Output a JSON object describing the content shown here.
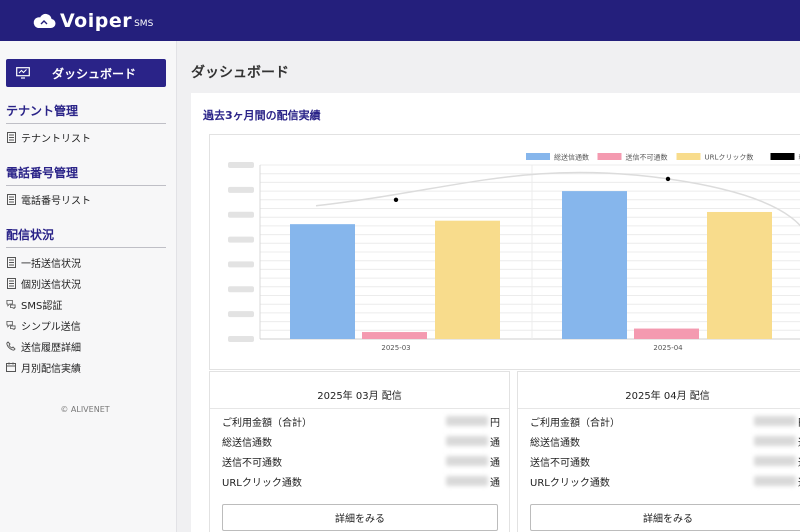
{
  "header": {
    "brand": "Voiper",
    "brand_sub": "SMS"
  },
  "sidebar": {
    "dashboard_label": "ダッシュボード",
    "sections": [
      {
        "title": "テナント管理",
        "items": [
          {
            "label": "テナントリスト",
            "icon": "list-icon"
          }
        ]
      },
      {
        "title": "電話番号管理",
        "items": [
          {
            "label": "電話番号リスト",
            "icon": "list-icon"
          }
        ]
      },
      {
        "title": "配信状況",
        "items": [
          {
            "label": "一括送信状況",
            "icon": "list-icon"
          },
          {
            "label": "個別送信状況",
            "icon": "list-icon"
          },
          {
            "label": "SMS認証",
            "icon": "chat-icon"
          },
          {
            "label": "シンプル送信",
            "icon": "chat-icon"
          },
          {
            "label": "送信履歴詳細",
            "icon": "phone-icon"
          },
          {
            "label": "月別配信実績",
            "icon": "calendar-icon"
          }
        ]
      }
    ],
    "copyright": "© ALIVENET"
  },
  "main": {
    "page_title": "ダッシュボード",
    "panel_title": "過去3ヶ月間の配信実績"
  },
  "chart_data": {
    "type": "bar",
    "categories": [
      "2025-03",
      "2025-04"
    ],
    "series": [
      {
        "name": "総送信通数",
        "values": [
          66,
          85
        ],
        "color": "#86b6ec"
      },
      {
        "name": "送信不可通数",
        "values": [
          4,
          6
        ],
        "color": "#f49ab0"
      },
      {
        "name": "URLクリック数",
        "values": [
          68,
          73
        ],
        "color": "#f8dc8c"
      },
      {
        "name": "料金",
        "line_values": [
          80,
          92
        ],
        "color": "#000000"
      }
    ],
    "ylim": [
      0,
      100
    ],
    "grid": true,
    "legend": "top"
  },
  "cards": [
    {
      "title": "2025年 03月 配信",
      "rows": [
        {
          "label": "ご利用金額（合計）",
          "unit": "円"
        },
        {
          "label": "総送信通数",
          "unit": "通"
        },
        {
          "label": "送信不可通数",
          "unit": "通"
        },
        {
          "label": "URLクリック通数",
          "unit": "通"
        }
      ],
      "button": "詳細をみる"
    },
    {
      "title": "2025年 04月 配信",
      "rows": [
        {
          "label": "ご利用金額（合計）",
          "unit": "円"
        },
        {
          "label": "総送信通数",
          "unit": "通"
        },
        {
          "label": "送信不可通数",
          "unit": "通"
        },
        {
          "label": "URLクリック通数",
          "unit": "通"
        }
      ],
      "button": "詳細をみる"
    }
  ]
}
